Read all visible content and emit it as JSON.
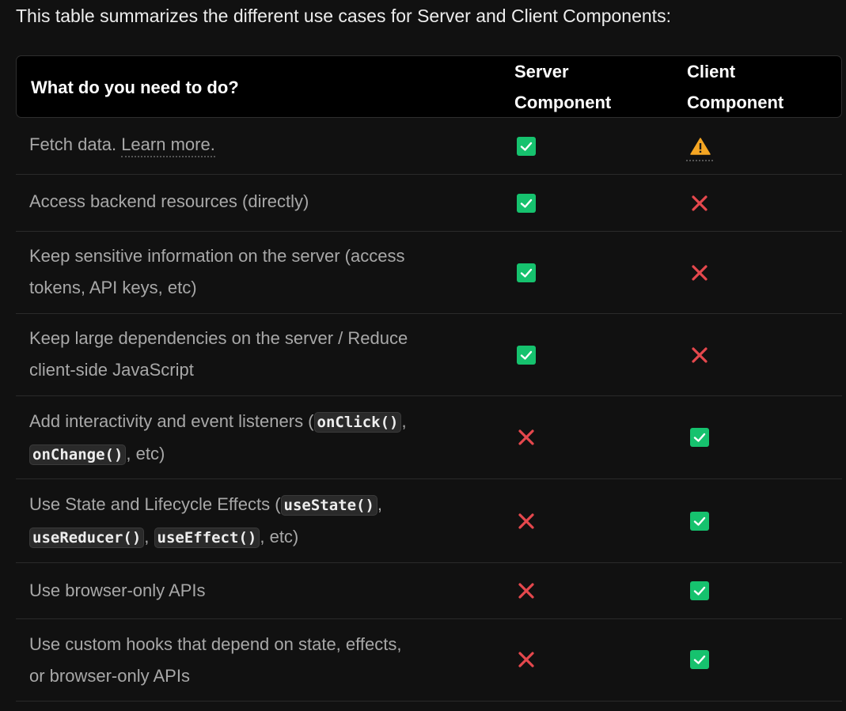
{
  "intro": "This table summarizes the different use cases for Server and Client Components:",
  "table": {
    "header": {
      "task": "What do you need to do?",
      "server_line1": "Server",
      "server_line2": "Component",
      "client_line1": "Client",
      "client_line2": "Component"
    },
    "rows": [
      {
        "text": "Fetch data. ",
        "link": "Learn more.",
        "server": "check",
        "client": "warning"
      },
      {
        "text": "Access backend resources (directly)",
        "server": "check",
        "client": "cross"
      },
      {
        "line1": "Keep sensitive information on the server (access",
        "line2": "tokens, API keys, etc)",
        "server": "check",
        "client": "cross"
      },
      {
        "line1": "Keep large dependencies on the server / Reduce",
        "line2": "client-side JavaScript",
        "server": "check",
        "client": "cross"
      },
      {
        "pre": "Add interactivity and event listeners (",
        "code1": "onClick()",
        "mid": ",",
        "code2": "onChange()",
        "post": ", etc)",
        "server": "cross",
        "client": "check"
      },
      {
        "pre": "Use State and Lifecycle Effects (",
        "code1": "useState()",
        "mid": ",",
        "code2": "useReducer()",
        "sep": ", ",
        "code3": "useEffect()",
        "post": ", etc)",
        "server": "cross",
        "client": "check"
      },
      {
        "text": "Use browser-only APIs",
        "server": "cross",
        "client": "check"
      },
      {
        "line1": "Use custom hooks that depend on state, effects,",
        "line2": "or browser-only APIs",
        "server": "cross",
        "client": "check"
      }
    ]
  },
  "colors": {
    "check": "#16c26e",
    "cross": "#e5484d",
    "warning": "#f5a623"
  }
}
